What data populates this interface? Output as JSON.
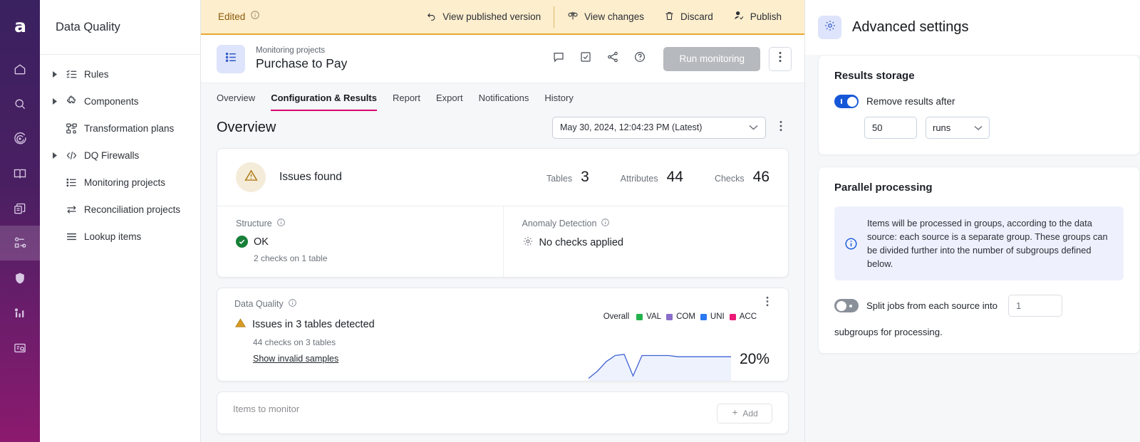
{
  "rail": {
    "logo": "a",
    "items": [
      {
        "name": "home-icon",
        "label": "Home",
        "active": false
      },
      {
        "name": "search-icon",
        "label": "Search",
        "active": false
      },
      {
        "name": "target-icon",
        "label": "Target",
        "active": false
      },
      {
        "name": "book-icon",
        "label": "Catalog",
        "active": false
      },
      {
        "name": "documents-icon",
        "label": "Documents",
        "active": false
      },
      {
        "name": "data-quality-icon",
        "label": "Data Quality",
        "active": true
      },
      {
        "name": "shield-icon",
        "label": "Security",
        "active": false
      },
      {
        "name": "bar-chart-icon",
        "label": "Analytics",
        "active": false
      },
      {
        "name": "query-icon",
        "label": "Query",
        "active": false
      }
    ]
  },
  "sidebar": {
    "title": "Data Quality",
    "items": [
      {
        "label": "Rules",
        "icon": "rules-icon",
        "expandable": true
      },
      {
        "label": "Components",
        "icon": "components-icon",
        "expandable": true
      },
      {
        "label": "Transformation plans",
        "icon": "transformation-plans-icon",
        "expandable": false
      },
      {
        "label": "DQ Firewalls",
        "icon": "code-icon",
        "expandable": true
      },
      {
        "label": "Monitoring projects",
        "icon": "monitoring-projects-icon",
        "expandable": false
      },
      {
        "label": "Reconciliation projects",
        "icon": "reconciliation-icon",
        "expandable": false
      },
      {
        "label": "Lookup items",
        "icon": "lookup-items-icon",
        "expandable": false
      }
    ]
  },
  "banner": {
    "status": "Edited",
    "actions": [
      {
        "label": "View published version",
        "icon": "undo-icon"
      },
      {
        "label": "View changes",
        "icon": "scales-icon"
      },
      {
        "label": "Discard",
        "icon": "trash-icon"
      },
      {
        "label": "Publish",
        "icon": "publish-user-icon"
      }
    ]
  },
  "header": {
    "breadcrumb": "Monitoring projects",
    "title": "Purchase to Pay",
    "icons": [
      {
        "name": "comment-icon"
      },
      {
        "name": "checkbox-icon"
      },
      {
        "name": "share-icon"
      },
      {
        "name": "help-icon"
      }
    ],
    "run_button": "Run monitoring",
    "more_label": "More options"
  },
  "tabs": [
    {
      "label": "Overview",
      "active": false
    },
    {
      "label": "Configuration & Results",
      "active": true
    },
    {
      "label": "Report",
      "active": false
    },
    {
      "label": "Export",
      "active": false
    },
    {
      "label": "Notifications",
      "active": false
    },
    {
      "label": "History",
      "active": false
    }
  ],
  "overview": {
    "heading": "Overview",
    "run_selected": "May 30, 2024, 12:04:23 PM (Latest)"
  },
  "summary": {
    "status": "Issues found",
    "stats": [
      {
        "key": "Tables",
        "value": "3"
      },
      {
        "key": "Attributes",
        "value": "44"
      },
      {
        "key": "Checks",
        "value": "46"
      }
    ],
    "structure": {
      "label": "Structure",
      "state": "OK",
      "sub": "2 checks on 1 table"
    },
    "anomaly": {
      "label": "Anomaly Detection",
      "state": "No checks applied"
    }
  },
  "data_quality": {
    "label": "Data Quality",
    "headline": "Issues in 3 tables detected",
    "sub": "44 checks on 3 tables",
    "link": "Show invalid samples",
    "percent": "20%",
    "legend_overall": "Overall",
    "legend": [
      {
        "label": "VAL",
        "color": "#22b24c"
      },
      {
        "label": "COM",
        "color": "#8a6ec9"
      },
      {
        "label": "UNI",
        "color": "#2979f2"
      },
      {
        "label": "ACC",
        "color": "#ec1a77"
      }
    ]
  },
  "chart_data": {
    "type": "line",
    "title": "Data Quality trend",
    "series": [
      {
        "name": "Overall",
        "color": "#3f63d4",
        "values": [
          2,
          8,
          16,
          21,
          22,
          4,
          21,
          21,
          21,
          21,
          20,
          20,
          20,
          20,
          20,
          20,
          20
        ]
      }
    ],
    "x": [
      1,
      2,
      3,
      4,
      5,
      6,
      7,
      8,
      9,
      10,
      11,
      12,
      13,
      14,
      15,
      16,
      17
    ],
    "ylim": [
      0,
      26
    ],
    "ylabel": "",
    "xlabel": "",
    "grid": false,
    "legend_position": "top-right",
    "annotation": "20%"
  },
  "next_section": {
    "label": "Items to monitor",
    "button": "Add"
  },
  "advanced": {
    "title": "Advanced settings",
    "results_storage": {
      "heading": "Results storage",
      "toggle_label": "Remove results after",
      "toggle_on": true,
      "amount": "50",
      "unit": "runs"
    },
    "parallel": {
      "heading": "Parallel processing",
      "info": "Items will be processed in groups, according to the data source: each source is a separate group. These groups can be divided further into the number of subgroups defined below.",
      "toggle_on": false,
      "split_label": "Split jobs from each source into",
      "split_value": "1",
      "split_tail": "subgroups for processing."
    }
  },
  "colors": {
    "accent_pink": "#d6006e",
    "accent_blue": "#1657d8",
    "banner_bg": "#fdeecd",
    "banner_border": "#e8a830",
    "warn": "#b07d18",
    "ok_green": "#188038"
  }
}
